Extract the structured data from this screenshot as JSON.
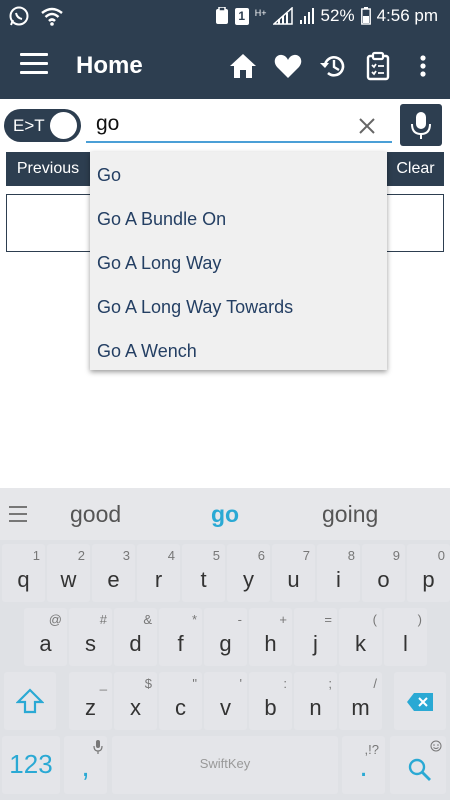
{
  "status_bar": {
    "network_label": "H+",
    "battery_percent": "52%",
    "time": "4:56 pm",
    "sim_label": "1"
  },
  "app_bar": {
    "title": "Home"
  },
  "search": {
    "toggle_label": "E>T",
    "query": "go"
  },
  "nav": {
    "previous_label": "Previous",
    "clear_label": "Clear"
  },
  "dropdown": {
    "items": [
      "Go",
      "Go A Bundle On",
      "Go A Long Way",
      "Go A Long Way Towards",
      "Go A Wench"
    ]
  },
  "keyboard": {
    "suggestions": [
      "good",
      "go",
      "going"
    ],
    "row1": [
      {
        "main": "q",
        "sub": "1"
      },
      {
        "main": "w",
        "sub": "2"
      },
      {
        "main": "e",
        "sub": "3"
      },
      {
        "main": "r",
        "sub": "4"
      },
      {
        "main": "t",
        "sub": "5"
      },
      {
        "main": "y",
        "sub": "6"
      },
      {
        "main": "u",
        "sub": "7"
      },
      {
        "main": "i",
        "sub": "8"
      },
      {
        "main": "o",
        "sub": "9"
      },
      {
        "main": "p",
        "sub": "0"
      }
    ],
    "row2": [
      {
        "main": "a",
        "sub": "@"
      },
      {
        "main": "s",
        "sub": "#"
      },
      {
        "main": "d",
        "sub": "&"
      },
      {
        "main": "f",
        "sub": "*"
      },
      {
        "main": "g",
        "sub": "-"
      },
      {
        "main": "h",
        "sub": "+"
      },
      {
        "main": "j",
        "sub": "="
      },
      {
        "main": "k",
        "sub": "("
      },
      {
        "main": "l",
        "sub": ")"
      }
    ],
    "row3": [
      {
        "main": "z",
        "sub": "_"
      },
      {
        "main": "x",
        "sub": "$"
      },
      {
        "main": "c",
        "sub": "\""
      },
      {
        "main": "v",
        "sub": "'"
      },
      {
        "main": "b",
        "sub": ":"
      },
      {
        "main": "n",
        "sub": ";"
      },
      {
        "main": "m",
        "sub": "/"
      }
    ],
    "numbers_label": "123",
    "comma_label": ",",
    "period_label": ".",
    "period_alt": ",!?",
    "brand_label": "SwiftKey",
    "accent_color": "#2aa9d4"
  },
  "colors": {
    "app_bar": "#2d3e50",
    "dropdown_text": "#243f63",
    "keyboard_bg": "#dfe1e5"
  }
}
